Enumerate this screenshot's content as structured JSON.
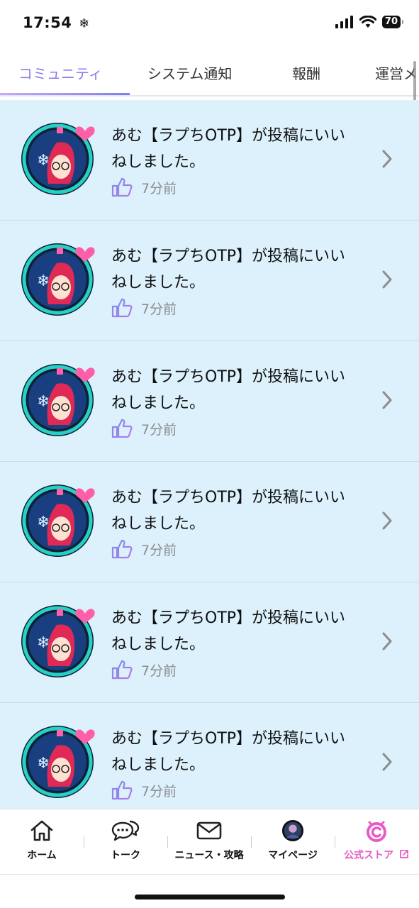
{
  "status_bar": {
    "time": "17:54",
    "battery": "70"
  },
  "tabs": [
    {
      "label": "コミュニティ",
      "active": true
    },
    {
      "label": "システム通知",
      "active": false
    },
    {
      "label": "報酬",
      "active": false
    },
    {
      "label": "運営メ",
      "active": false
    }
  ],
  "notifications": [
    {
      "text": "あむ【ラプちOTP】が投稿にいいねしました。",
      "time": "7分前"
    },
    {
      "text": "あむ【ラプちOTP】が投稿にいいねしました。",
      "time": "7分前"
    },
    {
      "text": "あむ【ラプちOTP】が投稿にいいねしました。",
      "time": "7分前"
    },
    {
      "text": "あむ【ラプちOTP】が投稿にいいねしました。",
      "time": "7分前"
    },
    {
      "text": "あむ【ラプちOTP】が投稿にいいねしました。",
      "time": "7分前"
    },
    {
      "text": "あむ【ラプちOTP】が投稿にいいねしました。",
      "time": "7分前"
    }
  ],
  "bottom_nav": [
    {
      "label": "ホーム",
      "icon": "home-icon"
    },
    {
      "label": "トーク",
      "icon": "chat-icon"
    },
    {
      "label": "ニュース・攻略",
      "icon": "mail-icon"
    },
    {
      "label": "マイページ",
      "icon": "avatar-icon"
    },
    {
      "label": "公式ストア",
      "icon": "store-icon"
    }
  ],
  "colors": {
    "accent": "#8a7ce8",
    "item_background": "#dcf1fc",
    "store": "#e85bc6"
  }
}
